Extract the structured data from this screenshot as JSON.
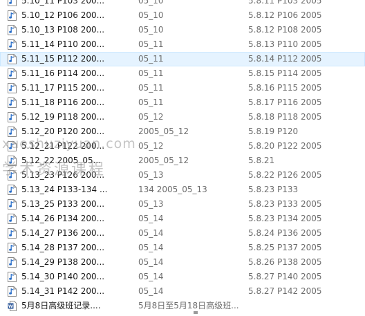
{
  "files": [
    {
      "name": "5.10_11 P103 200...",
      "album": "05_10",
      "title": "5.8.11 P103 2005",
      "type": "audio"
    },
    {
      "name": "5.10_12 P106 200...",
      "album": "05_10",
      "title": "5.8.12 P106 2005",
      "type": "audio"
    },
    {
      "name": "5.10_13 P108 200...",
      "album": "05_10",
      "title": "5.8.12 P108 2005",
      "type": "audio"
    },
    {
      "name": "5.11_14 P110 200...",
      "album": "05_11",
      "title": "5.8.13 P110 2005",
      "type": "audio"
    },
    {
      "name": "5.11_15 P112 200...",
      "album": "05_11",
      "title": "5.8.14 P112 2005",
      "type": "audio",
      "hovered": true
    },
    {
      "name": "5.11_16 P114 200...",
      "album": "05_11",
      "title": "5.8.15 P114 2005",
      "type": "audio"
    },
    {
      "name": "5.11_17 P115 200...",
      "album": "05_11",
      "title": "5.8.16 P115 2005",
      "type": "audio"
    },
    {
      "name": "5.11_18 P116 200...",
      "album": "05_11",
      "title": "5.8.17 P116 2005",
      "type": "audio"
    },
    {
      "name": "5.12_19 P118 200...",
      "album": "05_12",
      "title": "5.8.18 P118 2005",
      "type": "audio"
    },
    {
      "name": "5.12_20 P120 200...",
      "album": "2005_05_12",
      "title": "5.8.19 P120",
      "type": "audio"
    },
    {
      "name": "5.12_21 P122 200...",
      "album": "05_12",
      "title": "5.8.20 P122 2005",
      "type": "audio"
    },
    {
      "name": "5.12_22 2005_05...",
      "album": "2005_05_12",
      "title": "5.8.21",
      "type": "audio"
    },
    {
      "name": "5.13_23 P126 200...",
      "album": "05_13",
      "title": "5.8.22 P126 2005",
      "type": "audio"
    },
    {
      "name": "5.13_24 P133-134 ...",
      "album": "134 2005_05_13",
      "title": "5.8.23 P133",
      "type": "audio"
    },
    {
      "name": "5.13_25 P133 200...",
      "album": "05_13",
      "title": "5.8.23 P133 2005",
      "type": "audio"
    },
    {
      "name": "5.14_26 P134 200...",
      "album": "05_14",
      "title": "5.8.23 P134 2005",
      "type": "audio"
    },
    {
      "name": "5.14_27 P136 200...",
      "album": "05_14",
      "title": "5.8.24 P136 2005",
      "type": "audio"
    },
    {
      "name": "5.14_28 P137 200...",
      "album": "05_14",
      "title": "5.8.25 P137 2005",
      "type": "audio"
    },
    {
      "name": "5.14_29 P138 200...",
      "album": "05_14",
      "title": "5.8.26 P138 2005",
      "type": "audio"
    },
    {
      "name": "5.14_30 P140 200...",
      "album": "05_14",
      "title": "5.8.27 P140 2005",
      "type": "audio"
    },
    {
      "name": "5.14_31 P142 200...",
      "album": "05_14",
      "title": "5.8.27 P142 2005",
      "type": "audio"
    },
    {
      "name": "5月8日高级班记录....",
      "album": "5月8日至5月18日高级班...",
      "title": "",
      "type": "word"
    }
  ],
  "watermark": {
    "line1": "xueshuziyuan.com",
    "line2": "学术资源课程"
  },
  "colors": {
    "audio_icon": "#2a6fc9",
    "word_icon": "#2b579a",
    "hover_bg": "#e5f3ff"
  }
}
